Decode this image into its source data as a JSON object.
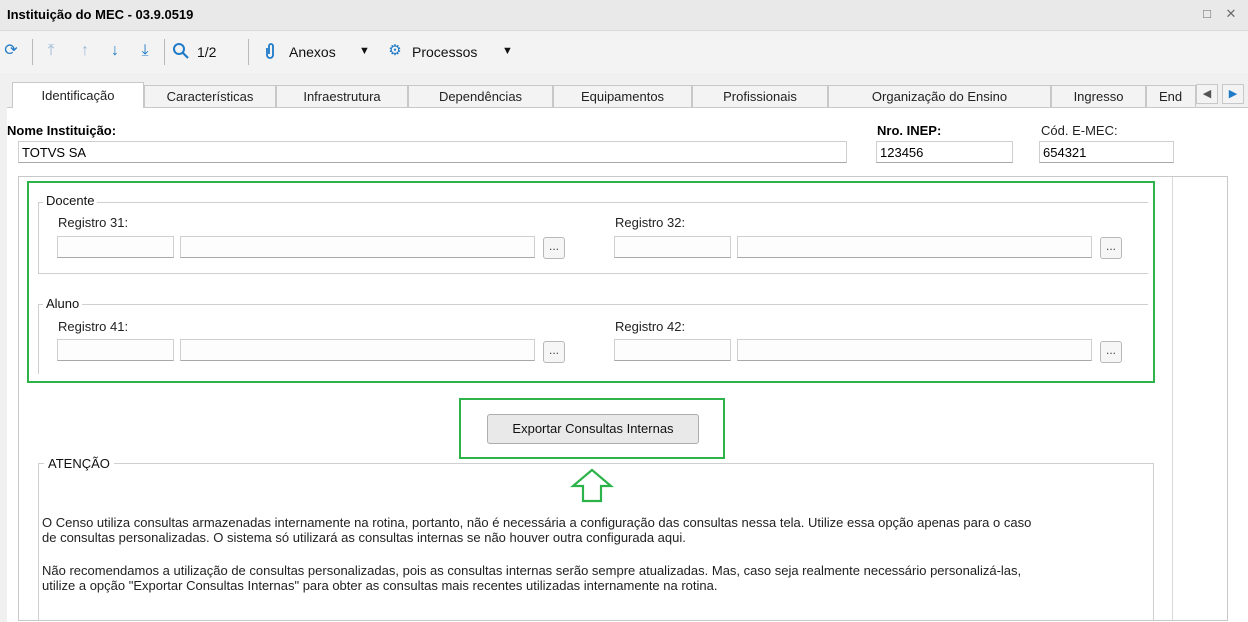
{
  "window": {
    "title": "Instituição do MEC - 03.9.0519"
  },
  "toolbar": {
    "page_indicator": "1/2",
    "attachments_label": "Anexos",
    "processes_label": "Processos"
  },
  "tabs": [
    {
      "label": "Identificação",
      "active": true
    },
    {
      "label": "Características"
    },
    {
      "label": "Infraestrutura"
    },
    {
      "label": "Dependências"
    },
    {
      "label": "Equipamentos"
    },
    {
      "label": "Profissionais"
    },
    {
      "label": "Organização do Ensino"
    },
    {
      "label": "Ingresso"
    },
    {
      "label": "End"
    }
  ],
  "form": {
    "institution_name_label": "Nome Instituição:",
    "institution_name_value": "TOTVS SA",
    "inep_label": "Nro. INEP:",
    "inep_value": "123456",
    "emec_label": "Cód. E-MEC:",
    "emec_value": "654321"
  },
  "docente": {
    "title": "Docente",
    "reg31_label": "Registro 31:",
    "reg32_label": "Registro 32:"
  },
  "aluno": {
    "title": "Aluno",
    "reg41_label": "Registro 41:",
    "reg42_label": "Registro 42:"
  },
  "lookup_button_label": "...",
  "export_button_label": "Exportar Consultas Internas",
  "attention": {
    "title": "ATENÇÃO",
    "paragraph1_line1": "O Censo utiliza consultas armazenadas internamente na rotina, portanto, não é necessária a configuração das consultas nessa tela. Utilize essa opção apenas para o caso",
    "paragraph1_line2": "de consultas personalizadas. O sistema só utilizará as consultas internas se não houver outra configurada aqui.",
    "paragraph2_line1": "Não recomendamos a utilização de consultas personalizadas, pois as consultas internas serão sempre atualizadas. Mas, caso seja realmente necessário personalizá-las,",
    "paragraph2_line2": "utilize a opção \"Exportar Consultas Internas\" para obter as consultas mais recentes utilizadas internamente na rotina."
  },
  "colors": {
    "highlight": "#2db34a",
    "icon_blue": "#1f7ac7"
  }
}
